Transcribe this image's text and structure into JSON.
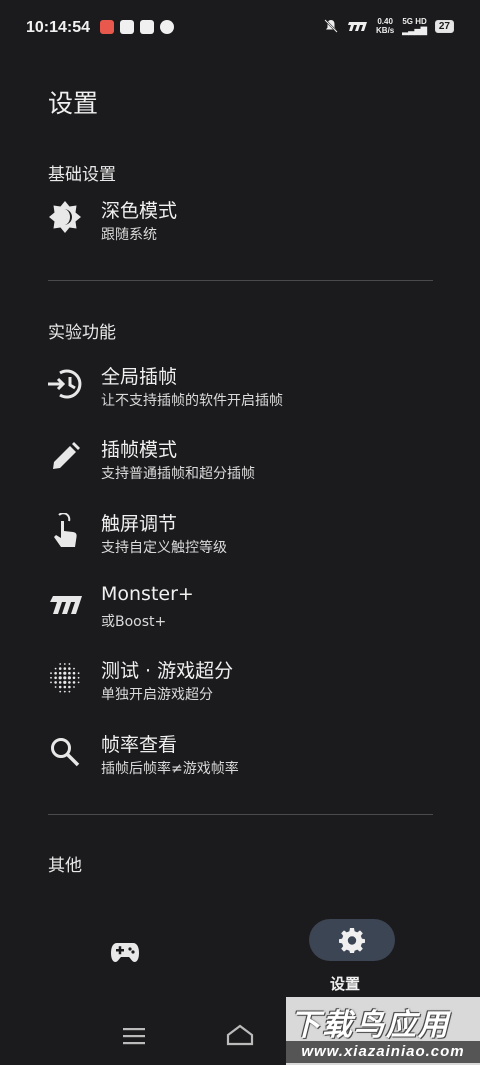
{
  "status_bar": {
    "time": "10:14:54",
    "net_speed_top": "0.40",
    "net_speed_bottom": "KB/s",
    "signal_top": "5G HD",
    "battery": "27"
  },
  "page": {
    "title": "设置"
  },
  "sections": {
    "basic": {
      "header": "基础设置",
      "items": [
        {
          "title": "深色模式",
          "subtitle": "跟随系统",
          "icon": "dark-mode-icon"
        }
      ]
    },
    "experimental": {
      "header": "实验功能",
      "items": [
        {
          "title": "全局插帧",
          "subtitle": "让不支持插帧的软件开启插帧",
          "icon": "global-interpolation-icon"
        },
        {
          "title": "插帧模式",
          "subtitle": "支持普通插帧和超分插帧",
          "icon": "pencil-icon"
        },
        {
          "title": "触屏调节",
          "subtitle": "支持自定义触控等级",
          "icon": "touch-icon"
        },
        {
          "title": "Monster+",
          "subtitle": "或Boost+",
          "icon": "monster-logo-icon"
        },
        {
          "title": "测试 · 游戏超分",
          "subtitle": "单独开启游戏超分",
          "icon": "dots-grid-icon"
        },
        {
          "title": "帧率查看",
          "subtitle": "插帧后帧率≠游戏帧率",
          "icon": "search-icon"
        }
      ]
    },
    "other": {
      "header": "其他"
    }
  },
  "bottom_nav": {
    "settings_label": "设置"
  },
  "watermark": {
    "top": "下载鸟应用",
    "bottom": "www.xiazainiao.com"
  },
  "colors": {
    "background": "#1b1b1d",
    "active_pill": "#3c4554",
    "divider": "#4a4a4c"
  }
}
